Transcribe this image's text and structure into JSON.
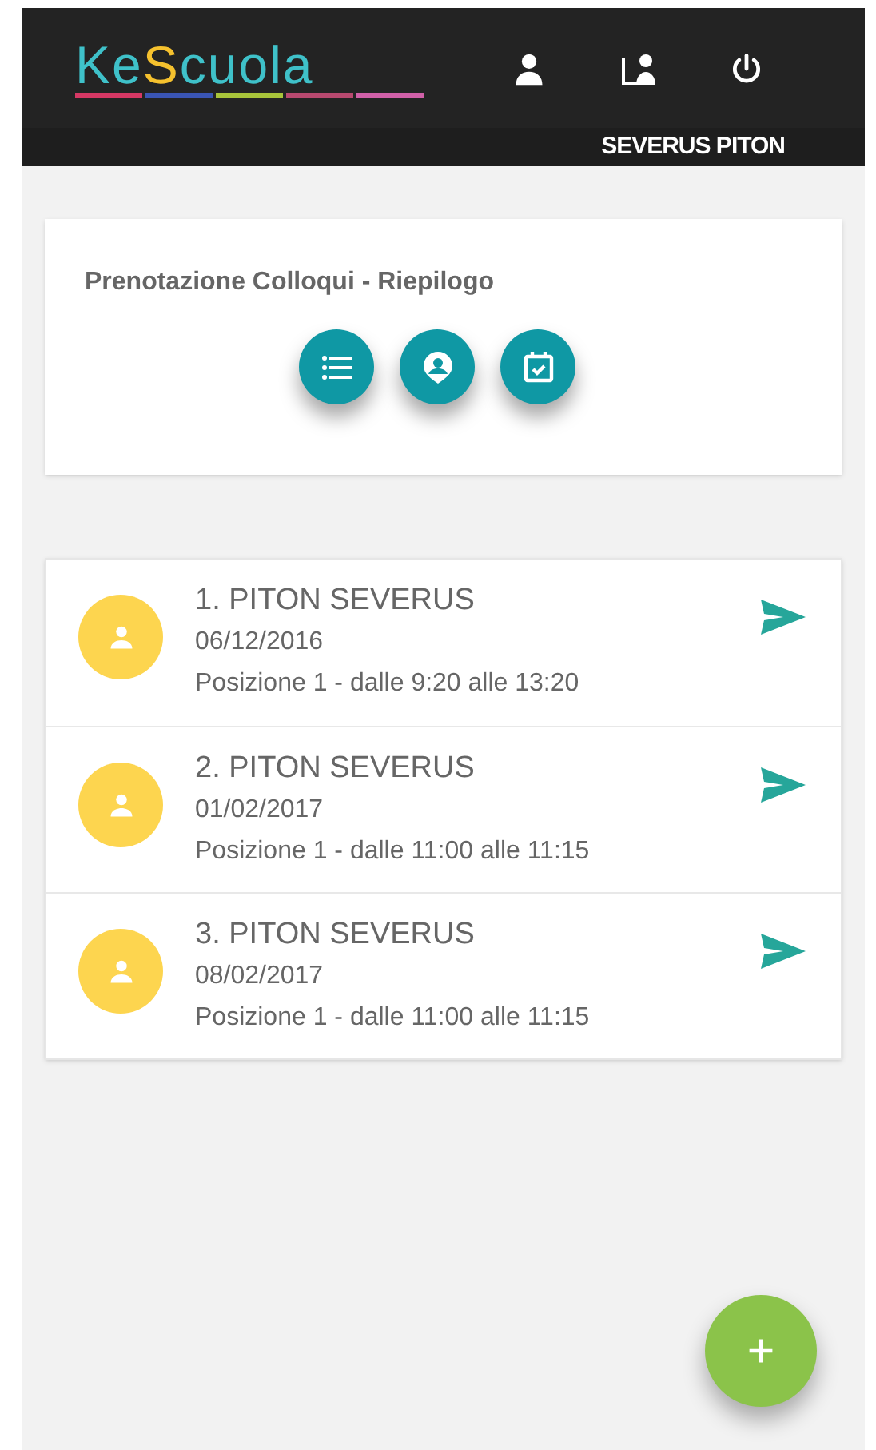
{
  "header": {
    "logo": [
      {
        "text": "Ke",
        "color": "#3fc1c9"
      },
      {
        "text": "S",
        "color": "#f5c12e"
      },
      {
        "text": "cuola",
        "color": "#3fc1c9"
      }
    ],
    "user_name": "SEVERUS PITON"
  },
  "summary": {
    "title": "Prenotazione Colloqui - Riepilogo"
  },
  "appointments": [
    {
      "title": "1. PITON SEVERUS",
      "date": "06/12/2016",
      "detail": "Posizione 1 - dalle 9:20 alle 13:20"
    },
    {
      "title": "2. PITON SEVERUS",
      "date": "01/02/2017",
      "detail": "Posizione 1 - dalle 11:00 alle 11:15"
    },
    {
      "title": "3. PITON SEVERUS",
      "date": "08/02/2017",
      "detail": "Posizione 1 - dalle 11:00 alle 11:15"
    }
  ]
}
